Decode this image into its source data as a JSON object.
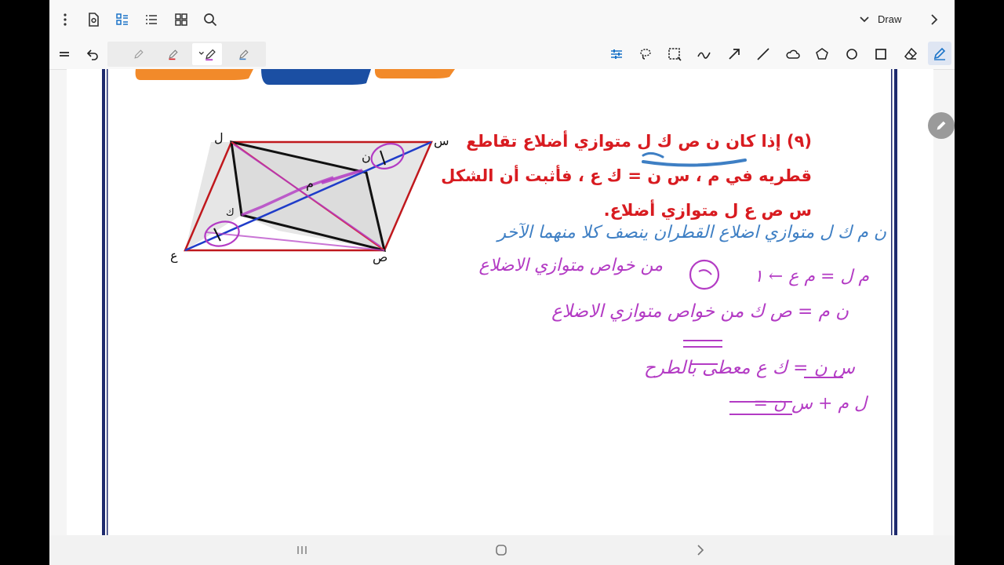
{
  "toolbar": {
    "mode_label": "Draw"
  },
  "problem": {
    "line1": "(٩) إذا كان ن ص ك ل متوازي أضلاع تقاطع",
    "line2": "قطريه في م ، س ن = ك ع ، فأثبت أن الشكل",
    "line3": "س ص ع ل متوازي أضلاع."
  },
  "figure": {
    "labels": {
      "L": "ل",
      "S": "س",
      "N": "ن",
      "M": "م",
      "K": "ك",
      "A": "ع",
      "Sad": "ص"
    }
  },
  "handwriting": [
    "ن م ك ل متوازي اضلاع  القطران ينصف كلا منهما الآخر",
    "م ل = م ع  ←  ١",
    "من خواص متوازي الاضلاع",
    "ن م = ص ك  من خواص متوازي الاضلاع",
    "س ن = ك ع  معطى  بالطرح",
    "ل م + س ن ="
  ],
  "colors": {
    "problem_text": "#d81b20",
    "blue_ink": "#3e7fc4",
    "purple_ink": "#b33bc4",
    "accent_icon": "#1a73c8"
  }
}
